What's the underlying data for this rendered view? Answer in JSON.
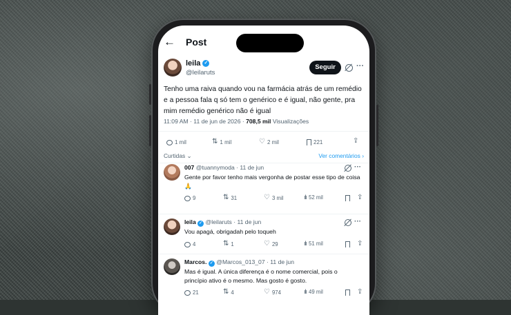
{
  "header": {
    "title": "Post",
    "back_icon": "arrow-left-icon"
  },
  "post": {
    "author_name": "leila",
    "author_handle": "@leilaruts",
    "follow_label": "Seguir",
    "text": "Tenho uma raiva quando vou na farmácia atrás de um remédio e a pessoa fala q só tem o genérico e é igual, não gente, pra mim remédio genérico não é igual",
    "time": "11:09 AM · 11 de jun de 2026 · ",
    "views_count": "708,5 mil",
    "views_label": " Visualizações",
    "stats": {
      "replies": "1 mil",
      "retweets": "1 mil",
      "likes": "2 mil",
      "bookmarks": "221"
    },
    "liked_by_label": "Curtidas",
    "view_replies_label": "Ver comentários"
  },
  "replies": [
    {
      "name": "007",
      "handle": "@tuannymoda",
      "date": "· 11 de jun",
      "text": "Gente por favor tenho mais vergonha de postar esse tipo de coisa 🙏",
      "replies": "9",
      "retweets": "31",
      "likes": "3 mil",
      "views": "52 mil"
    },
    {
      "name": "leila",
      "handle": "@leilaruts",
      "date": "· 11 de jun",
      "text": "Vou apagá, obrigadah pelo toqueh",
      "replies": "4",
      "retweets": "1",
      "likes": "29",
      "views": "51 mil"
    },
    {
      "name": "Marcos.",
      "handle": "@Marcos_013_07",
      "date": "· 11 de jun",
      "text": "Mas é igual. A única diferença é o nome comercial, pois o princípio ativo é o mesmo. Mas gosto é gosto.",
      "replies": "21",
      "retweets": "4",
      "likes": "974",
      "views": "49 mil"
    }
  ],
  "colors": {
    "accent": "#1d9bf0",
    "text": "#0f1419",
    "muted": "#536471"
  }
}
